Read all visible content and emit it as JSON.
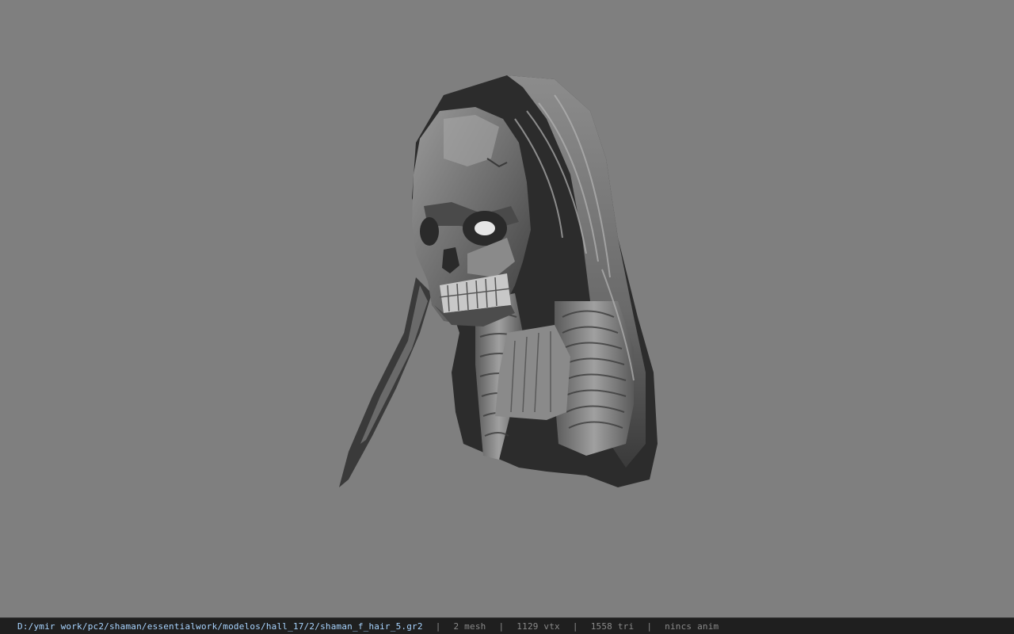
{
  "viewport": {
    "background_color": "#7f7f7f",
    "model_name": "shaman_f_hair_5"
  },
  "statusbar": {
    "file_path": "D:/ymir work/pc2/shaman/essentialwork/modelos/hall_17/2/shaman_f_hair_5.gr2",
    "separator": "|",
    "mesh_count": "2 mesh",
    "vertex_count": "1129 vtx",
    "triangle_count": "1558 tri",
    "anim_status": "nincs anim",
    "path_color": "#a8d4ff",
    "stat_color": "#8a8a8a"
  }
}
